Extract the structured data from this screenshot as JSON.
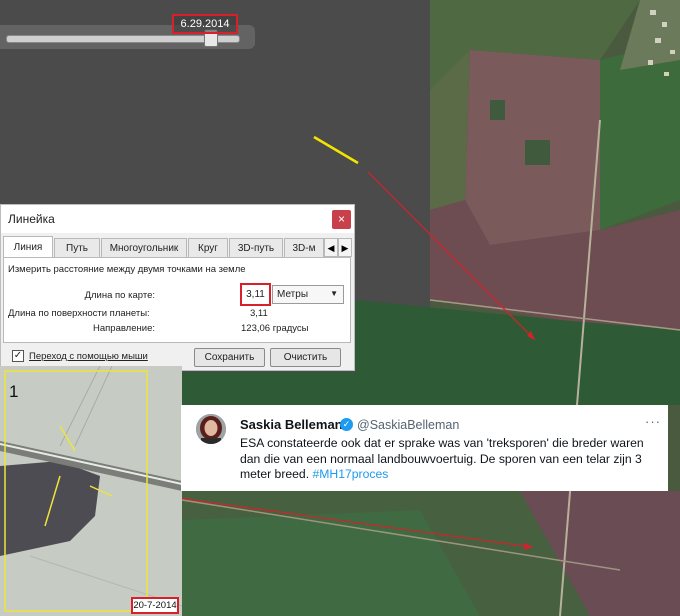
{
  "timeline": {
    "date": "6.29.2014",
    "position": 0.88
  },
  "ruler": {
    "title": "Линейка",
    "close_symbol": "×",
    "tabs": [
      "Линия",
      "Путь",
      "Многоугольник",
      "Круг",
      "3D-путь",
      "3D-м"
    ],
    "active_tab": "Линия",
    "scroll_left": "◀",
    "scroll_right": "▶",
    "description": "Измерить расстояние между двумя точками на земле",
    "map_length_label": "Длина по карте:",
    "map_length_value": "3,11",
    "unit": "Метры",
    "ground_length_label": "Длина по поверхности планеты:",
    "ground_length_value": "3,11",
    "heading_label": "Направление:",
    "heading_value": "123,06 градусы",
    "mouse_nav_label": "Переход с помощью мыши",
    "mouse_nav_checked": "✓",
    "save_label": "Сохранить",
    "clear_label": "Очистить"
  },
  "inset": {
    "number": "1",
    "date": "20-7-2014"
  },
  "tweet": {
    "name": "Saskia Belleman",
    "handle": "@SaskiaBelleman",
    "more": "···",
    "verified_symbol": "✓",
    "text": "ESA constateerde ook dat er sprake was van 'treksporen' die breder waren dan die van een normaal landbouwvoertuig. De sporen van een telar zijn 3 meter breed. ",
    "hashtag": "#MH17proces"
  },
  "colors": {
    "highlight": "#d8202a",
    "ruler_line": "#f2e600",
    "verified": "#1d9bf0",
    "hashtag": "#1d9bf0"
  }
}
